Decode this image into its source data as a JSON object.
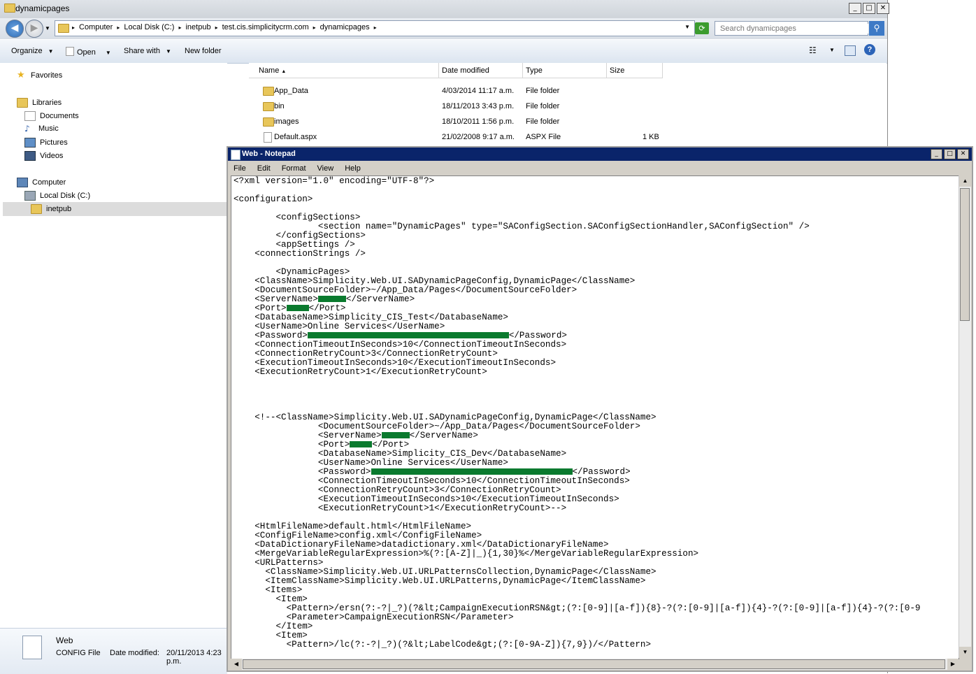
{
  "explorer": {
    "title": "dynamicpages",
    "breadcrumb": [
      "Computer",
      "Local Disk (C:)",
      "inetpub",
      "test.cis.simplicitycrm.com",
      "dynamicpages"
    ],
    "search_placeholder": "Search dynamicpages",
    "toolbar": {
      "organize": "Organize",
      "open": "Open",
      "share_with": "Share with",
      "new_folder": "New folder"
    },
    "nav": {
      "favorites": "Favorites",
      "libraries": "Libraries",
      "documents": "Documents",
      "music": "Music",
      "pictures": "Pictures",
      "videos": "Videos",
      "computer": "Computer",
      "local_disk": "Local Disk (C:)",
      "inetpub": "inetpub"
    },
    "columns": {
      "name": "Name",
      "date_modified": "Date modified",
      "type": "Type",
      "size": "Size"
    },
    "files": [
      {
        "name": "App_Data",
        "date": "4/03/2014 11:17 a.m.",
        "type": "File folder",
        "size": ""
      },
      {
        "name": "bin",
        "date": "18/11/2013 3:43 p.m.",
        "type": "File folder",
        "size": ""
      },
      {
        "name": "images",
        "date": "18/10/2011 1:56 p.m.",
        "type": "File folder",
        "size": ""
      },
      {
        "name": "Default.aspx",
        "date": "21/02/2008 9:17 a.m.",
        "type": "ASPX File",
        "size": "1 KB"
      }
    ],
    "details": {
      "name": "Web",
      "type": "CONFIG File",
      "date_label": "Date modified:",
      "date": "20/11/2013 4:23 p.m."
    }
  },
  "notepad": {
    "title": "Web - Notepad",
    "menu": [
      "File",
      "Edit",
      "Format",
      "View",
      "Help"
    ],
    "lines": [
      "<?xml version=\"1.0\" encoding=\"UTF-8\"?>",
      "",
      "<configuration>",
      "",
      "        <configSections>",
      "                <section name=\"DynamicPages\" type=\"SAConfigSection.SAConfigSectionHandler,SAConfigSection\" />",
      "        </configSections>",
      "        <appSettings />",
      "    <connectionStrings />",
      "",
      "        <DynamicPages>",
      "    <ClassName>Simplicity.Web.UI.SADynamicPageConfig,DynamicPage</ClassName>",
      "    <DocumentSourceFolder>~/App_Data/Pages</DocumentSourceFolder>",
      "    <ServerName>",
      "    <Port>",
      "    <DatabaseName>Simplicity_CIS_Test</DatabaseName>",
      "    <UserName>Online Services</UserName>",
      "    <Password>",
      "    <ConnectionTimeoutInSeconds>10</ConnectionTimeoutInSeconds>",
      "    <ConnectionRetryCount>3</ConnectionRetryCount>",
      "    <ExecutionTimeoutInSeconds>10</ExecutionTimeoutInSeconds>",
      "    <ExecutionRetryCount>1</ExecutionRetryCount>",
      "",
      "",
      "",
      "",
      "    <!--<ClassName>Simplicity.Web.UI.SADynamicPageConfig,DynamicPage</ClassName>",
      "                <DocumentSourceFolder>~/App_Data/Pages</DocumentSourceFolder>",
      "                <ServerName>",
      "                <Port>",
      "                <DatabaseName>Simplicity_CIS_Dev</DatabaseName>",
      "                <UserName>Online Services</UserName>",
      "                <Password>",
      "                <ConnectionTimeoutInSeconds>10</ConnectionTimeoutInSeconds>",
      "                <ConnectionRetryCount>3</ConnectionRetryCount>",
      "                <ExecutionTimeoutInSeconds>10</ExecutionTimeoutInSeconds>",
      "                <ExecutionRetryCount>1</ExecutionRetryCount>-->",
      "",
      "    <HtmlFileName>default.html</HtmlFileName>",
      "    <ConfigFileName>config.xml</ConfigFileName>",
      "    <DataDictionaryFileName>datadictionary.xml</DataDictionaryFileName>",
      "    <MergeVariableRegularExpression>%(?:[A-Z]|_){1,30}%</MergeVariableRegularExpression>",
      "    <URLPatterns>",
      "      <ClassName>Simplicity.Web.UI.URLPatternsCollection,DynamicPage</ClassName>",
      "      <ItemClassName>Simplicity.Web.UI.URLPatterns,DynamicPage</ItemClassName>",
      "      <Items>",
      "        <Item>",
      "          <Pattern>/ersn(?:-?|_?)(?&lt;CampaignExecutionRSN&gt;(?:[0-9]|[a-f]){8}-?(?:[0-9]|[a-f]){4}-?(?:[0-9]|[a-f]){4}-?(?:[0-9",
      "          <Parameter>CampaignExecutionRSN</Parameter>",
      "        </Item>",
      "        <Item>",
      "          <Pattern>/lc(?:-?|_?)(?&lt;LabelCode&gt;(?:[0-9A-Z]){7,9})/</Pattern>"
    ],
    "redacted_tails": {
      "13": "</ServerName>",
      "14": "</Port>",
      "17": "</Password>",
      "28": "</ServerName>",
      "29": "</Port>",
      "32": "</Password>"
    }
  }
}
